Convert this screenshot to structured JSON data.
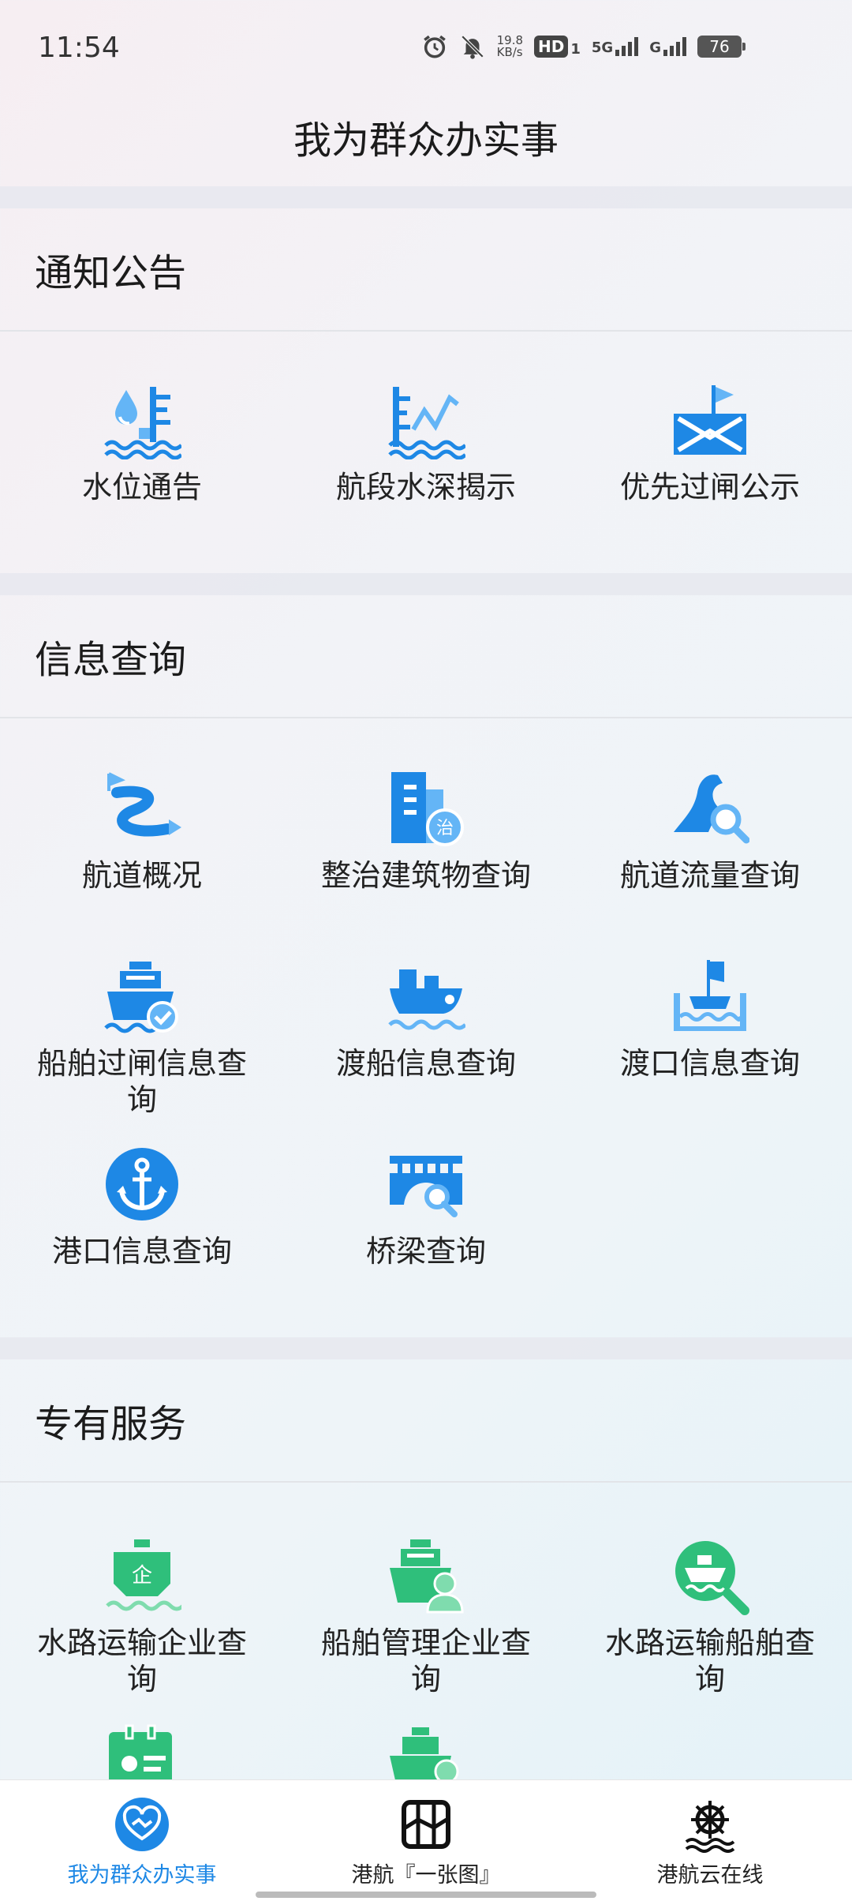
{
  "status_bar": {
    "time": "11:54",
    "speed_value": "19.8",
    "speed_unit": "KB/s",
    "hd": "HD",
    "hd_sub": "1",
    "signal1": "5G",
    "signal2": "G",
    "battery": "76"
  },
  "header": {
    "title": "我为群众办实事"
  },
  "sections": {
    "notice": {
      "title": "通知公告",
      "items": [
        {
          "label": "水位通告",
          "icon": "water-level-icon"
        },
        {
          "label": "航段水深揭示",
          "icon": "channel-depth-icon"
        },
        {
          "label": "优先过闸公示",
          "icon": "priority-lock-icon"
        }
      ]
    },
    "info": {
      "title": "信息查询",
      "items": [
        {
          "label": "航道概况",
          "icon": "channel-overview-icon"
        },
        {
          "label": "整治建筑物查询",
          "icon": "regulation-building-icon"
        },
        {
          "label": "航道流量查询",
          "icon": "channel-flow-icon"
        },
        {
          "label": "船舶过闸信息查询",
          "icon": "ship-lock-icon"
        },
        {
          "label": "渡船信息查询",
          "icon": "ferry-icon"
        },
        {
          "label": "渡口信息查询",
          "icon": "ferry-dock-icon"
        },
        {
          "label": "港口信息查询",
          "icon": "anchor-icon"
        },
        {
          "label": "桥梁查询",
          "icon": "bridge-icon"
        }
      ]
    },
    "service": {
      "title": "专有服务",
      "items": [
        {
          "label": "水路运输企业查询",
          "icon": "transport-enterprise-icon",
          "badge": "企"
        },
        {
          "label": "船舶管理企业查询",
          "icon": "ship-management-icon"
        },
        {
          "label": "水路运输船舶查询",
          "icon": "transport-ship-icon"
        }
      ]
    }
  },
  "bottom_nav": [
    {
      "label": "我为群众办实事",
      "icon": "handshake-heart-icon",
      "active": true
    },
    {
      "label": "港航『一张图』",
      "icon": "map-icon",
      "active": false
    },
    {
      "label": "港航云在线",
      "icon": "helm-icon",
      "active": false
    }
  ],
  "colors": {
    "accent_blue": "#1e88e5",
    "service_green": "#2fbf7b",
    "light_blue": "#64b5f6"
  }
}
